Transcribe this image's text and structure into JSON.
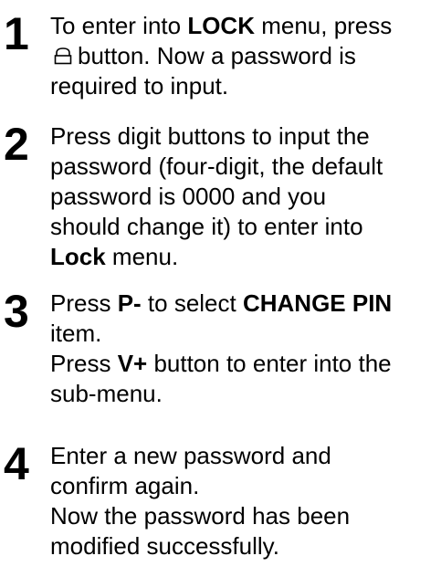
{
  "steps": [
    {
      "number": "1",
      "lines": [
        {
          "pre": "To enter into ",
          "bold": "LOCK",
          "post": " menu, press"
        },
        {
          "icon": "lock-icon",
          "text": "button. Now a password is"
        },
        {
          "text": "required to input."
        }
      ]
    },
    {
      "number": "2",
      "lines": [
        {
          "text": "Press digit buttons to input the"
        },
        {
          "text": "password (four-digit, the default"
        },
        {
          "text": "password is 0000 and you"
        },
        {
          "text": "should change it) to enter into"
        },
        {
          "bold": "Lock",
          "post": " menu."
        }
      ]
    },
    {
      "number": "3",
      "lines": [
        {
          "pre": "Press ",
          "bold": "P-",
          "mid": " to select ",
          "bold2": "CHANGE PIN"
        },
        {
          "text": "item."
        },
        {
          "pre": "Press ",
          "bold": "V+",
          "post": " button to enter into the"
        },
        {
          "text": "sub-menu."
        }
      ]
    },
    {
      "number": "4",
      "lines": [
        {
          "text": "Enter a new password and"
        },
        {
          "text": "confirm again."
        },
        {
          "text": "Now the password has been"
        },
        {
          "text": "modified successfully."
        }
      ]
    }
  ]
}
